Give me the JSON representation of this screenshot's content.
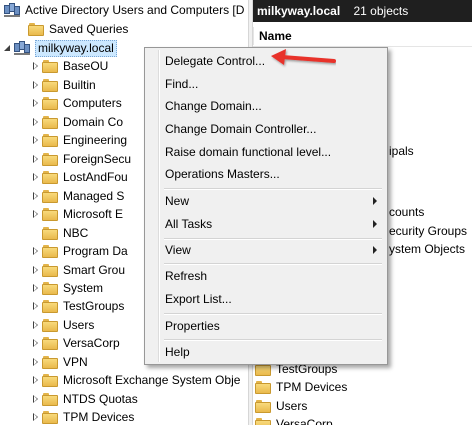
{
  "left_tree": {
    "title": "Active Directory Users and Computers [D",
    "saved_queries": "Saved Queries",
    "domain": "milkyway.local",
    "children": [
      {
        "label": "BaseOU",
        "expandable": true
      },
      {
        "label": "Builtin",
        "expandable": true
      },
      {
        "label": "Computers",
        "expandable": true
      },
      {
        "label": "Domain Co",
        "expandable": true
      },
      {
        "label": "Engineering",
        "expandable": true
      },
      {
        "label": "ForeignSecu",
        "expandable": true
      },
      {
        "label": "LostAndFou",
        "expandable": true
      },
      {
        "label": "Managed S",
        "expandable": true
      },
      {
        "label": "Microsoft E",
        "expandable": true
      },
      {
        "label": "NBC",
        "expandable": false
      },
      {
        "label": "Program Da",
        "expandable": true
      },
      {
        "label": "Smart Grou",
        "expandable": true
      },
      {
        "label": "System",
        "expandable": true
      },
      {
        "label": "TestGroups",
        "expandable": true
      },
      {
        "label": "Users",
        "expandable": true
      },
      {
        "label": "VersaCorp",
        "expandable": true
      },
      {
        "label": "VPN",
        "expandable": true
      },
      {
        "label": "Microsoft Exchange System Obje",
        "expandable": true
      },
      {
        "label": "NTDS Quotas",
        "expandable": true
      },
      {
        "label": "TPM Devices",
        "expandable": true
      }
    ]
  },
  "right_pane": {
    "header_title": "milkyway.local",
    "header_count": "21 objects",
    "column_name": "Name",
    "fragments": [
      "ipals",
      "counts",
      "ecurity Groups",
      "ystem Objects"
    ],
    "rows": [
      "TestGroups",
      "TPM Devices",
      "Users",
      "VersaCorp"
    ]
  },
  "context_menu": {
    "items": [
      "Delegate Control...",
      "Find...",
      "Change Domain...",
      "Change Domain Controller...",
      "Raise domain functional level...",
      "Operations Masters...",
      "New",
      "All Tasks",
      "View",
      "Refresh",
      "Export List...",
      "Properties",
      "Help"
    ]
  },
  "colors": {
    "header_bg": "#1f1f1f",
    "menu_bg": "#f0f0f0",
    "callout_arrow": "#e8302c",
    "folder": "#f2c864"
  }
}
